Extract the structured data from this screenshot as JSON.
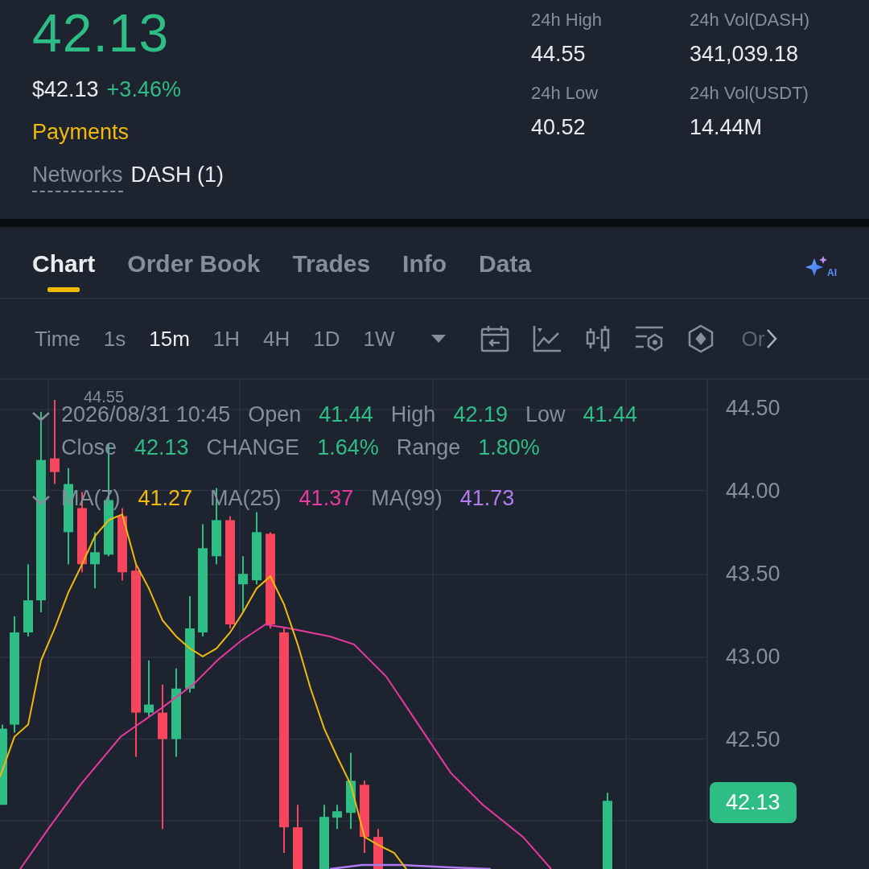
{
  "ticker": {
    "price": "42.13",
    "fiat_price": "$42.13",
    "change": "+3.46%",
    "tag": "Payments",
    "networks_label": "Networks",
    "networks_value": "DASH (1)"
  },
  "stats": [
    {
      "label": "24h High",
      "value": "44.55"
    },
    {
      "label": "24h Vol(DASH)",
      "value": "341,039.18"
    },
    {
      "label": "24h Low",
      "value": "40.52"
    },
    {
      "label": "24h Vol(USDT)",
      "value": "14.44M"
    }
  ],
  "tabs": [
    {
      "label": "Chart",
      "selected": true
    },
    {
      "label": "Order Book",
      "selected": false
    },
    {
      "label": "Trades",
      "selected": false
    },
    {
      "label": "Info",
      "selected": false
    },
    {
      "label": "Data",
      "selected": false
    }
  ],
  "ai_label": "AI",
  "intervals": [
    {
      "label": "Time",
      "selected": false
    },
    {
      "label": "1s",
      "selected": false
    },
    {
      "label": "15m",
      "selected": true
    },
    {
      "label": "1H",
      "selected": false
    },
    {
      "label": "4H",
      "selected": false
    },
    {
      "label": "1D",
      "selected": false
    },
    {
      "label": "1W",
      "selected": false
    }
  ],
  "toolbar_more": "Or",
  "chart": {
    "high_marker": "44.55",
    "datetime": "2026/08/31 10:45",
    "fields": [
      {
        "label": "Open",
        "value": "41.44"
      },
      {
        "label": "High",
        "value": "42.19"
      },
      {
        "label": "Low",
        "value": "41.44"
      },
      {
        "label": "Close",
        "value": "42.13"
      },
      {
        "label": "CHANGE",
        "value": "1.64%"
      },
      {
        "label": "Range",
        "value": "1.80%"
      }
    ],
    "ma": [
      {
        "label": "MA(7)",
        "value": "41.27",
        "color": "#f0b90b"
      },
      {
        "label": "MA(25)",
        "value": "41.37",
        "color": "#e8399e"
      },
      {
        "label": "MA(99)",
        "value": "41.73",
        "color": "#b07cf0"
      }
    ],
    "price_ticks": [
      "44.50",
      "44.00",
      "43.50",
      "43.00",
      "42.50"
    ],
    "last_price": "42.13"
  }
}
